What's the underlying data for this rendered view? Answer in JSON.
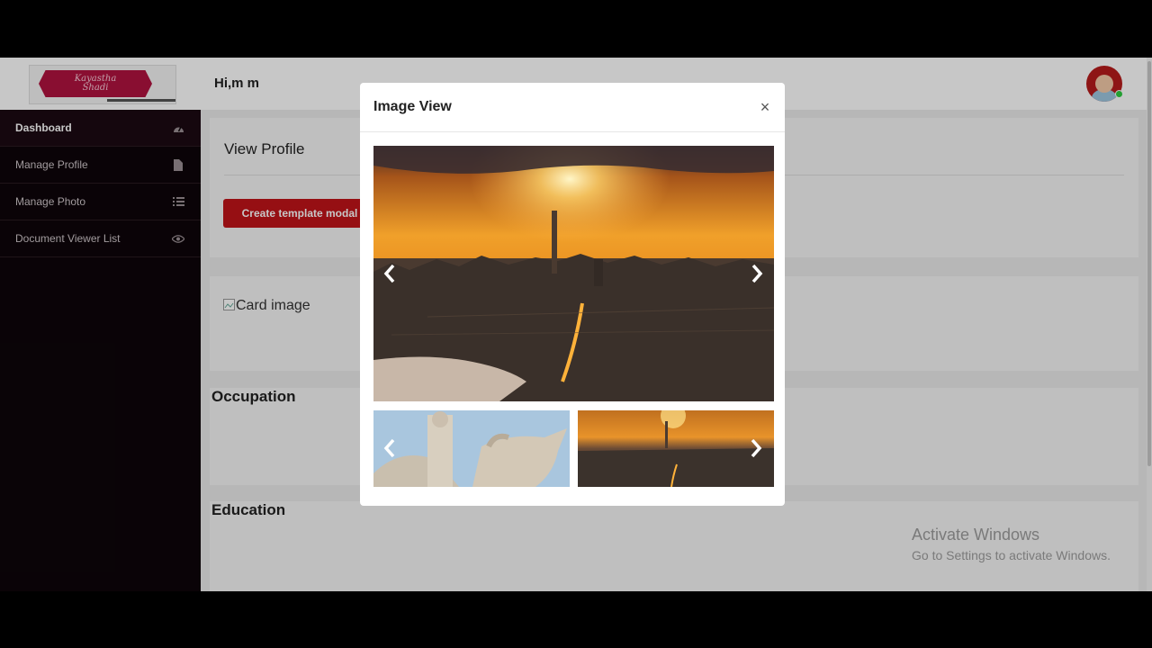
{
  "header": {
    "logo_line1": "Kayastha",
    "logo_line2": "Shadi",
    "greeting": "Hi,m m",
    "avatar_icon": "user-avatar-icon"
  },
  "sidebar": {
    "items": [
      {
        "label": "Dashboard",
        "icon": "dashboard-icon"
      },
      {
        "label": "Manage Profile",
        "icon": "file-icon"
      },
      {
        "label": "Manage Photo",
        "icon": "list-icon"
      },
      {
        "label": "Document Viewer List",
        "icon": "eye-icon"
      }
    ]
  },
  "main": {
    "profile_title": "View Profile",
    "create_button": "Create template modal",
    "card_image_alt": "Card image",
    "occupation_title": "Occupation",
    "education_title": "Education"
  },
  "modal": {
    "title": "Image View",
    "close_symbol": "×",
    "prev_icon": "chevron-left-icon",
    "next_icon": "chevron-right-icon"
  },
  "watermark": {
    "line1": "Activate Windows",
    "line2": "Go to Settings to activate Windows."
  },
  "colors": {
    "sidebar_bg": "#0d0509",
    "accent_red": "#c11419",
    "online_dot": "#2ecc40"
  }
}
